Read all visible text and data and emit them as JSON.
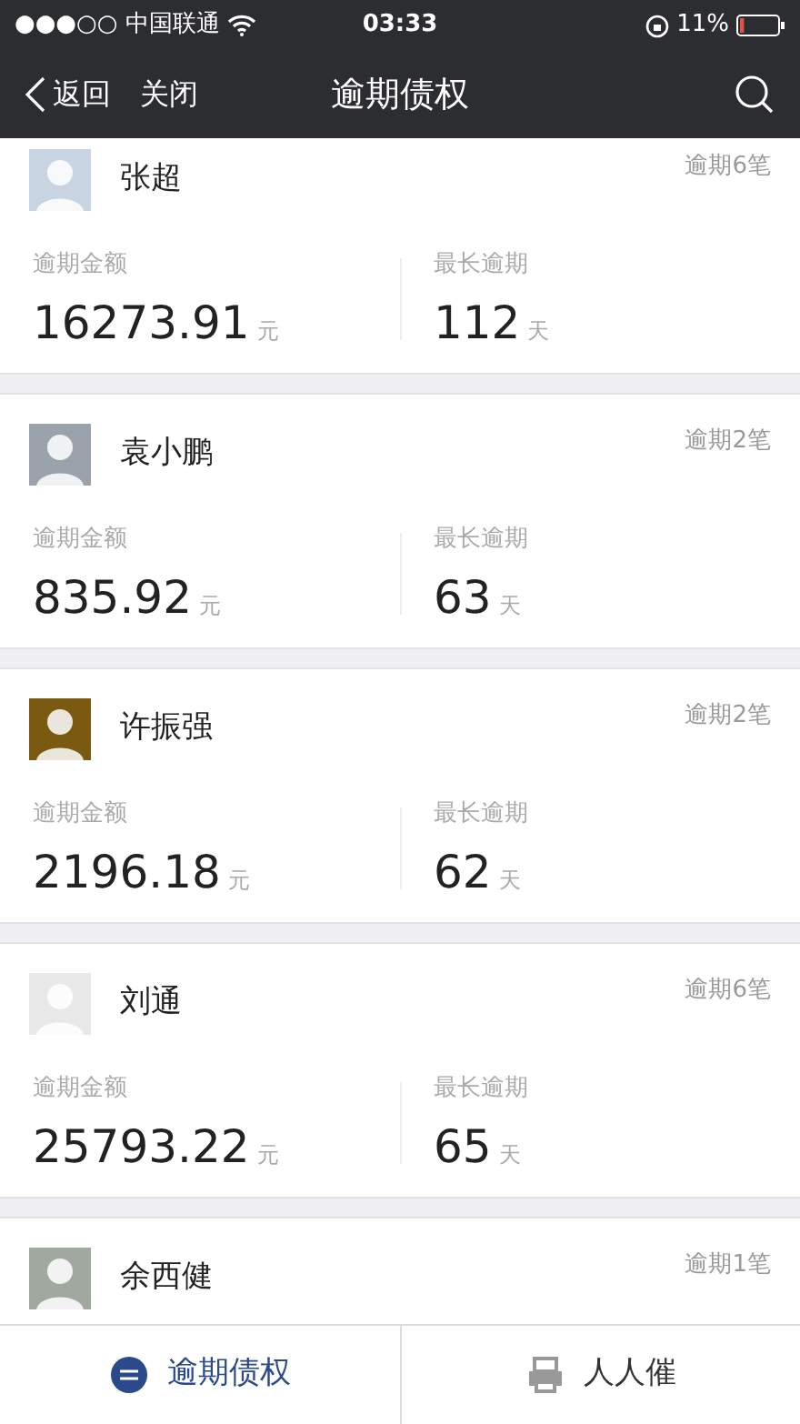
{
  "status_bar": {
    "carrier": "●●●○○ 中国联通",
    "time": "03:33",
    "battery": "11%"
  },
  "nav": {
    "back": "返回",
    "close": "关闭",
    "title": "逾期债权"
  },
  "debtors": [
    {
      "name": "张超",
      "count": "逾期6笔",
      "amount_label": "逾期金额",
      "amount": "16273.91",
      "amount_unit": "元",
      "days_label": "最长逾期",
      "days": "112",
      "days_unit": "天"
    },
    {
      "name": "袁小鹏",
      "count": "逾期2笔",
      "amount_label": "逾期金额",
      "amount": "835.92",
      "amount_unit": "元",
      "days_label": "最长逾期",
      "days": "63",
      "days_unit": "天"
    },
    {
      "name": "许振强",
      "count": "逾期2笔",
      "amount_label": "逾期金额",
      "amount": "2196.18",
      "amount_unit": "元",
      "days_label": "最长逾期",
      "days": "62",
      "days_unit": "天"
    },
    {
      "name": "刘通",
      "count": "逾期6笔",
      "amount_label": "逾期金额",
      "amount": "25793.22",
      "amount_unit": "元",
      "days_label": "最长逾期",
      "days": "65",
      "days_unit": "天"
    },
    {
      "name": "余西健",
      "count": "逾期1笔"
    }
  ],
  "tabs": [
    {
      "label": "逾期债权",
      "selected": true
    },
    {
      "label": "人人催",
      "selected": false
    }
  ]
}
